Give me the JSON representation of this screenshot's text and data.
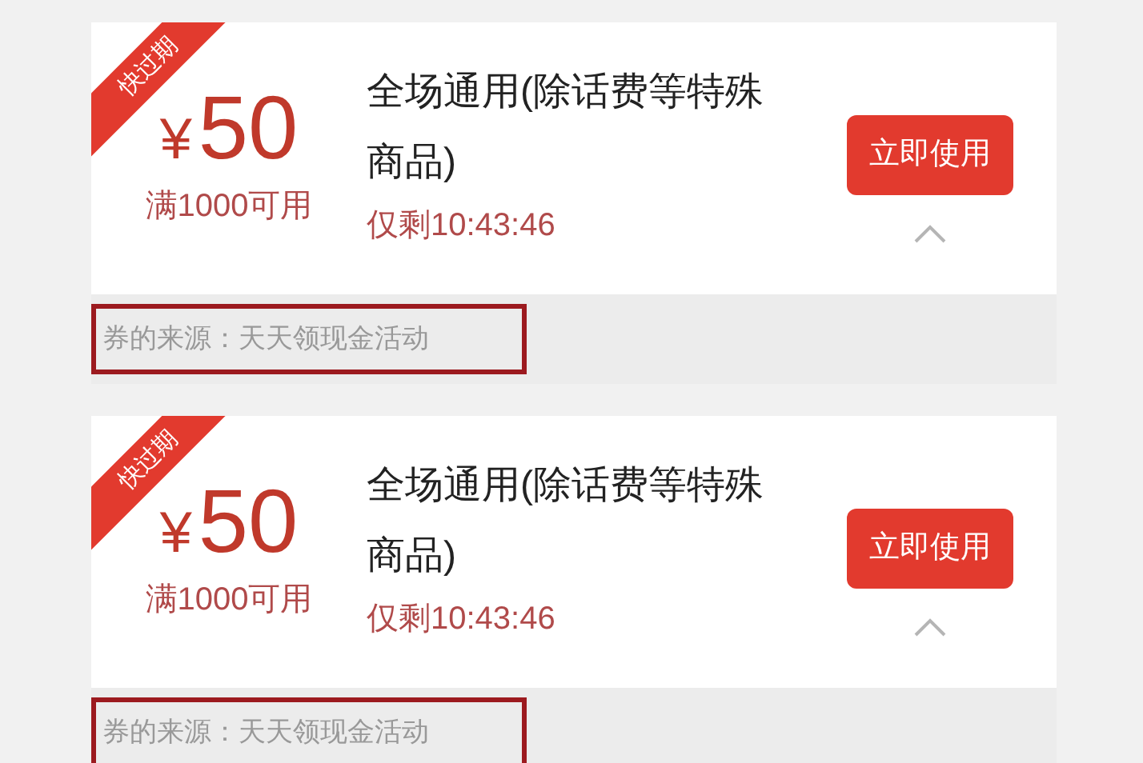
{
  "coupons": [
    {
      "badge": "快过期",
      "currency": "¥",
      "amount": "50",
      "condition": "满1000可用",
      "title": "全场通用(除话费等特殊商品)",
      "countdown": "仅剩10:43:46",
      "button": "立即使用",
      "expanded": true,
      "source": "券的来源：天天领现金活动",
      "source_highlighted": true
    },
    {
      "badge": "快过期",
      "currency": "¥",
      "amount": "50",
      "condition": "满1000可用",
      "title": "全场通用(除话费等特殊商品)",
      "countdown": "仅剩10:43:46",
      "button": "立即使用",
      "expanded": true,
      "source": "券的来源：天天领现金活动",
      "source_highlighted": true
    }
  ]
}
